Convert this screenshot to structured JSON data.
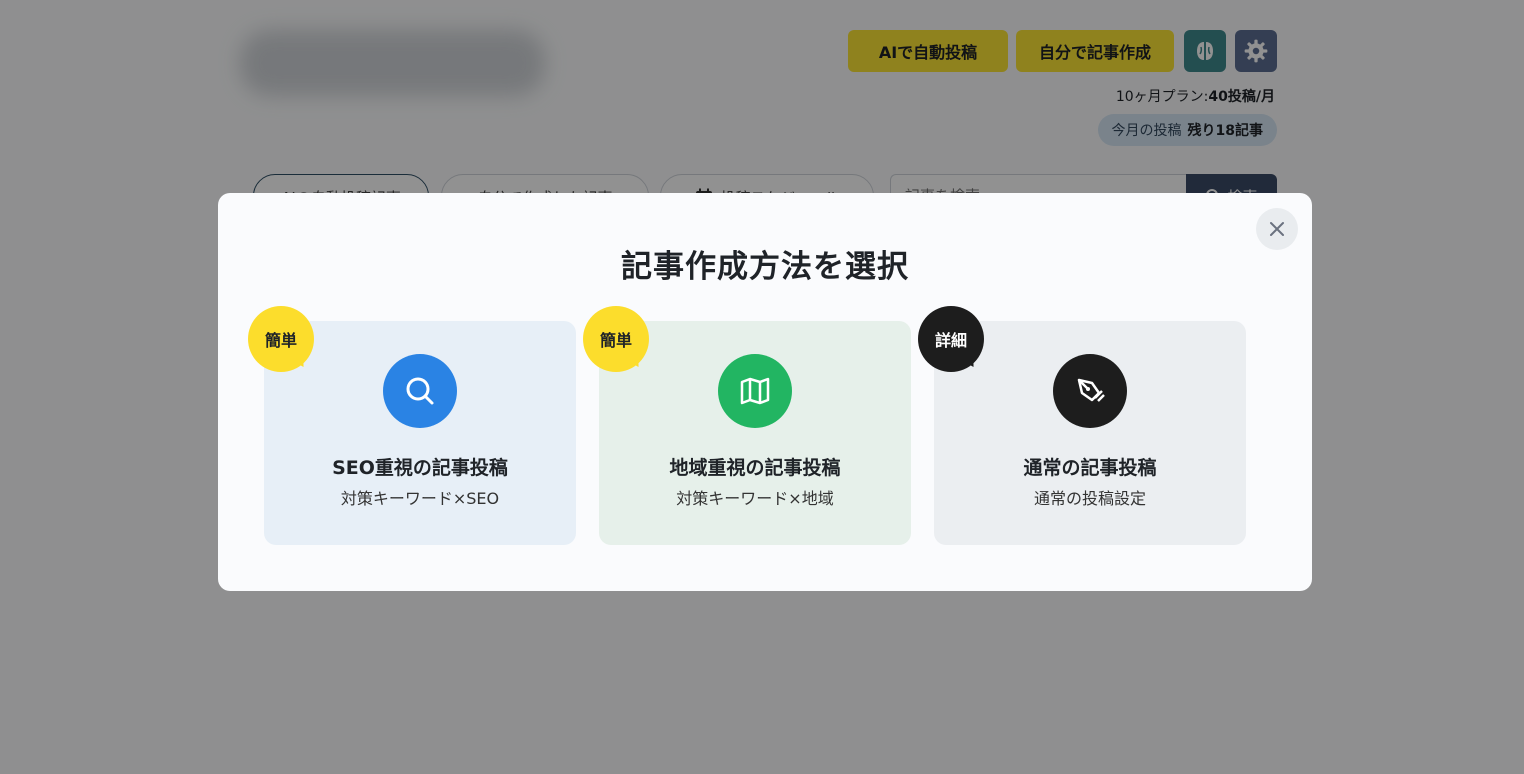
{
  "header": {
    "ai_post_button": "AIで自動投稿",
    "self_post_button": "自分で記事作成",
    "plan_label": "10ヶ月プラン:",
    "plan_value": "40投稿/月",
    "quota_label": "今月の投稿",
    "quota_value": "残り18記事"
  },
  "tabs": [
    {
      "label": "AIの自動投稿記事"
    },
    {
      "label": "自分で作成した記事"
    },
    {
      "label": "投稿スケジュール"
    }
  ],
  "search": {
    "placeholder": "記事を検索",
    "button_label": "検索"
  },
  "modal": {
    "title": "記事作成方法を選択",
    "cards": [
      {
        "badge": "簡単",
        "title": "SEO重視の記事投稿",
        "subtitle": "対策キーワード×SEO",
        "icon": "search-icon",
        "color": "#2a83e4"
      },
      {
        "badge": "簡単",
        "title": "地域重視の記事投稿",
        "subtitle": "対策キーワード×地域",
        "icon": "map-icon",
        "color": "#22b562"
      },
      {
        "badge": "詳細",
        "title": "通常の記事投稿",
        "subtitle": "通常の投稿設定",
        "icon": "pen-nib-icon",
        "color": "#1d1d1d"
      }
    ]
  },
  "colors": {
    "accent_yellow": "#fce435",
    "overlay": "rgba(0,0,0,0.43)",
    "search_button": "#3b4a66"
  }
}
